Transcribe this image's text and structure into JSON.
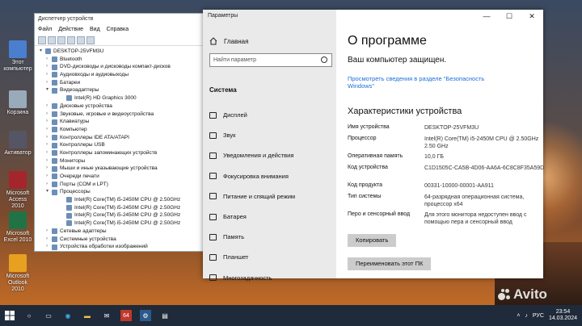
{
  "desktop": {
    "icons": [
      {
        "label": "Этот компьютер",
        "color": "#4a7fd0"
      },
      {
        "label": "Корзина",
        "color": "#9ab"
      },
      {
        "label": "Активатор",
        "color": "#556"
      },
      {
        "label": "Microsoft Access 2010",
        "color": "#a4262c"
      },
      {
        "label": "Microsoft Excel 2010",
        "color": "#217346"
      },
      {
        "label": "Microsoft Outlook 2010",
        "color": "#e8a020"
      }
    ]
  },
  "devmgr": {
    "title": "Диспетчер устройств",
    "menu": [
      "Файл",
      "Действие",
      "Вид",
      "Справка"
    ],
    "tree": [
      {
        "label": "DESKTOP-25VFM3U",
        "level": 0,
        "arrow": "▾"
      },
      {
        "label": "Bluetooth",
        "level": 1,
        "arrow": "›"
      },
      {
        "label": "DVD-дисководы и дисководы компакт-дисков",
        "level": 1,
        "arrow": "›"
      },
      {
        "label": "Аудиовходы и аудиовыходы",
        "level": 1,
        "arrow": "›"
      },
      {
        "label": "Батареи",
        "level": 1,
        "arrow": "›"
      },
      {
        "label": "Видеоадаптеры",
        "level": 1,
        "arrow": "▾"
      },
      {
        "label": "Intel(R) HD Graphics 3000",
        "level": 2,
        "arrow": ""
      },
      {
        "label": "Дисковые устройства",
        "level": 1,
        "arrow": "›"
      },
      {
        "label": "Звуковые, игровые и видеоустройства",
        "level": 1,
        "arrow": "›"
      },
      {
        "label": "Клавиатуры",
        "level": 1,
        "arrow": "›"
      },
      {
        "label": "Компьютер",
        "level": 1,
        "arrow": "›"
      },
      {
        "label": "Контроллеры IDE ATA/ATAPI",
        "level": 1,
        "arrow": "›"
      },
      {
        "label": "Контроллеры USB",
        "level": 1,
        "arrow": "›"
      },
      {
        "label": "Контроллеры запоминающих устройств",
        "level": 1,
        "arrow": "›"
      },
      {
        "label": "Мониторы",
        "level": 1,
        "arrow": "›"
      },
      {
        "label": "Мыши и иные указывающие устройства",
        "level": 1,
        "arrow": "›"
      },
      {
        "label": "Очереди печати",
        "level": 1,
        "arrow": "›"
      },
      {
        "label": "Порты (COM и LPT)",
        "level": 1,
        "arrow": "›"
      },
      {
        "label": "Процессоры",
        "level": 1,
        "arrow": "▾"
      },
      {
        "label": "Intel(R) Core(TM) i5-2450M CPU @ 2.50GHz",
        "level": 2,
        "arrow": ""
      },
      {
        "label": "Intel(R) Core(TM) i5-2450M CPU @ 2.50GHz",
        "level": 2,
        "arrow": ""
      },
      {
        "label": "Intel(R) Core(TM) i5-2450M CPU @ 2.50GHz",
        "level": 2,
        "arrow": ""
      },
      {
        "label": "Intel(R) Core(TM) i5-2450M CPU @ 2.50GHz",
        "level": 2,
        "arrow": ""
      },
      {
        "label": "Сетевые адаптеры",
        "level": 1,
        "arrow": "›"
      },
      {
        "label": "Системные устройства",
        "level": 1,
        "arrow": "›"
      },
      {
        "label": "Устройства обработки изображений",
        "level": 1,
        "arrow": "›"
      }
    ]
  },
  "settings": {
    "window_title": "Параметры",
    "home": "Главная",
    "search_placeholder": "Найти параметр",
    "section": "Система",
    "nav": [
      "Дисплей",
      "Звук",
      "Уведомления и действия",
      "Фокусировка внимания",
      "Питание и спящий режим",
      "Батарея",
      "Память",
      "Планшет",
      "Многозадачность"
    ],
    "page_title": "О программе",
    "protected": "Ваш компьютер защищен.",
    "security_link": "Просмотреть сведения в разделе \"Безопасность Windows\"",
    "specs_title": "Характеристики устройства",
    "specs": [
      {
        "key": "Имя устройства",
        "value": "DESKTOP-25VFM3U"
      },
      {
        "key": "Процессор",
        "value": "Intel(R) Core(TM) i5-2450M CPU @ 2.50GHz   2.50 GHz"
      },
      {
        "key": "Оперативная память",
        "value": "10,0 ГБ"
      },
      {
        "key": "Код устройства",
        "value": "C1D1505C-CA5B-4D06-AA6A-6C8C8F35A59D"
      },
      {
        "key": "Код продукта",
        "value": "00331-10000-00001-AA911"
      },
      {
        "key": "Тип системы",
        "value": "64-разрядная операционная система, процессор x64"
      },
      {
        "key": "Перо и сенсорный ввод",
        "value": "Для этого монитора недоступен ввод с помощью пера и сенсорный ввод"
      }
    ],
    "copy_button": "Копировать",
    "rename_button": "Переименовать этот ПК"
  },
  "taskbar": {
    "badge": "64",
    "lang": "РУС",
    "time": "23:54",
    "date": "14.03.2024"
  },
  "watermark": "Avito"
}
